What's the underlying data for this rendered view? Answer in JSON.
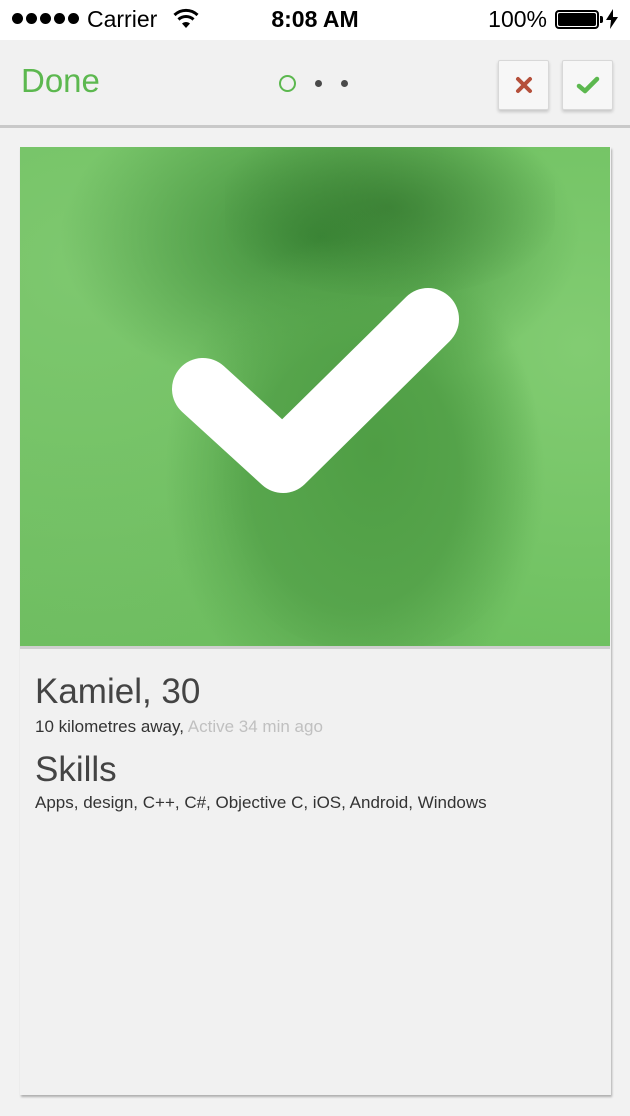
{
  "status_bar": {
    "carrier": "Carrier",
    "time": "8:08 AM",
    "battery": "100%"
  },
  "nav": {
    "done_label": "Done",
    "page_count": 3,
    "active_page": 1,
    "reject_icon": "close-icon",
    "accept_icon": "checkmark-icon"
  },
  "profile": {
    "name_age": "Kamiel, 30",
    "distance": "10 kilometres away,",
    "active": "Active 34 min ago",
    "skills_title": "Skills",
    "skills": "Apps, design, C++, C#, Objective C, iOS, Android, Windows"
  },
  "colors": {
    "accent_green": "#5cb84f",
    "reject_red": "#b5503b",
    "photo_overlay": "#6cbf5e"
  }
}
